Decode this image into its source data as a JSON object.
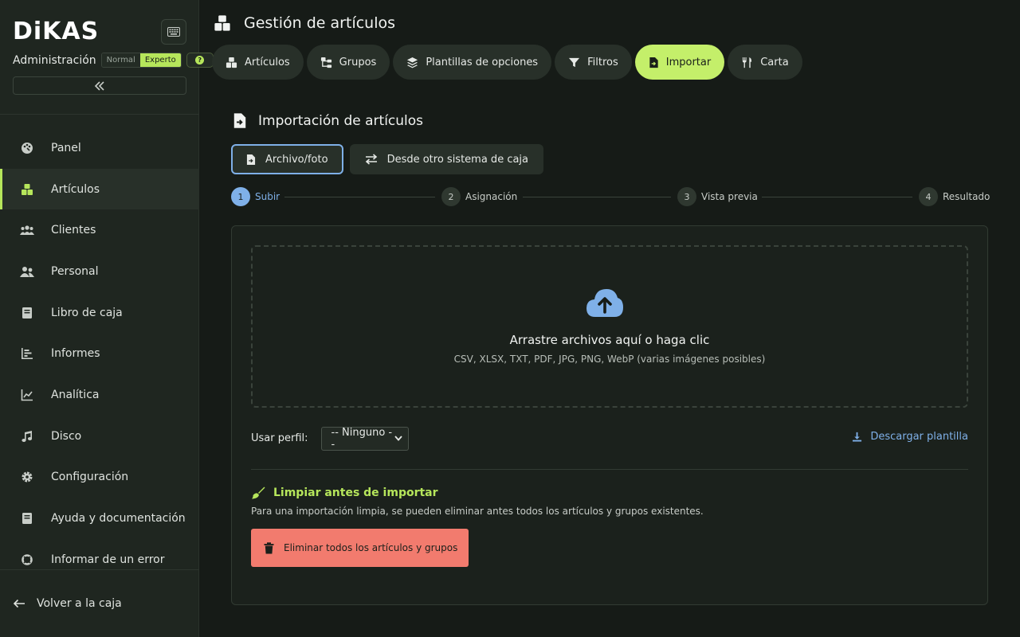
{
  "brand": {
    "logo": "DiKAS"
  },
  "sidebar": {
    "admin_label": "Administración",
    "mode_normal": "Normal",
    "mode_expert": "Experto",
    "help_badge": "?",
    "items": [
      {
        "label": "Panel",
        "icon": "palette-icon"
      },
      {
        "label": "Artículos",
        "icon": "boxes-icon",
        "active": true
      },
      {
        "label": "Clientes",
        "icon": "users-icon"
      },
      {
        "label": "Personal",
        "icon": "user-group-icon"
      },
      {
        "label": "Libro de caja",
        "icon": "book-icon"
      },
      {
        "label": "Informes",
        "icon": "bar-chart-icon"
      },
      {
        "label": "Analítica",
        "icon": "line-chart-icon"
      },
      {
        "label": "Disco",
        "icon": "music-icon"
      },
      {
        "label": "Configuración",
        "icon": "gear-icon"
      },
      {
        "label": "Ayuda y documentación",
        "icon": "book-icon"
      },
      {
        "label": "Informar de un error",
        "icon": "lifebuoy-icon"
      }
    ],
    "back_label": "Volver a la caja"
  },
  "header": {
    "title": "Gestión de artículos"
  },
  "tabs": [
    {
      "label": "Artículos",
      "icon": "boxes-icon"
    },
    {
      "label": "Grupos",
      "icon": "folder-tree-icon"
    },
    {
      "label": "Plantillas de opciones",
      "icon": "layers-icon"
    },
    {
      "label": "Filtros",
      "icon": "filter-icon"
    },
    {
      "label": "Importar",
      "icon": "file-import-icon",
      "active": true
    },
    {
      "label": "Carta",
      "icon": "utensils-icon"
    }
  ],
  "import": {
    "title": "Importación de artículos",
    "subtabs": [
      {
        "label": "Archivo/foto",
        "icon": "file-import-icon",
        "active": true
      },
      {
        "label": "Desde otro sistema de caja",
        "icon": "arrows-exchange-icon"
      }
    ],
    "steps": [
      {
        "num": "1",
        "label": "Subir"
      },
      {
        "num": "2",
        "label": "Asignación"
      },
      {
        "num": "3",
        "label": "Vista previa"
      },
      {
        "num": "4",
        "label": "Resultado"
      }
    ],
    "active_step": 1,
    "dropzone": {
      "title": "Arrastre archivos aquí o haga clic",
      "formats": "CSV, XLSX, TXT, PDF, JPG, PNG, WebP (varias imágenes posibles)"
    },
    "profile": {
      "label": "Usar perfil:",
      "selected": "-- Ninguno --"
    },
    "download_label": "Descargar plantilla",
    "clean": {
      "title": "Limpiar antes de importar",
      "description": "Para una importación limpia, se pueden eliminar antes todos los artículos y grupos existentes.",
      "button_label": "Eliminar todos los artículos y grupos"
    }
  },
  "colors": {
    "accent": "#b6e65b",
    "active_tab": "#c4ef6a",
    "link": "#7fb0e8",
    "danger": "#f27b6e",
    "background": "#161b17",
    "sidebar": "#1f2620"
  }
}
